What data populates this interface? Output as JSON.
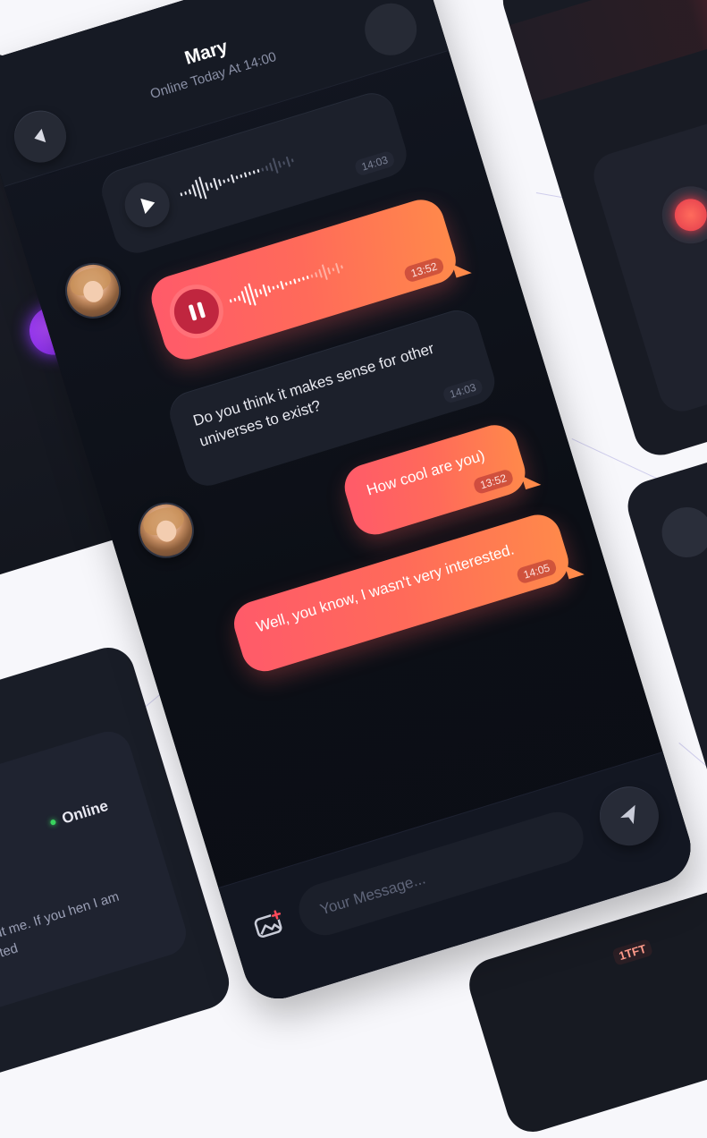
{
  "chat": {
    "contact_name": "Mary",
    "contact_status": "Online Today At 14:00",
    "messages": [
      {
        "type": "voice",
        "direction": "incoming",
        "time": "14:03"
      },
      {
        "type": "voice",
        "direction": "outgoing",
        "time": "13:52",
        "playing": true
      },
      {
        "type": "text",
        "direction": "incoming",
        "text": "Do you think it makes sense for other universes to exist?",
        "time": "14:03"
      },
      {
        "type": "text",
        "direction": "outgoing",
        "text": "How cool are you)",
        "time": "13:52"
      },
      {
        "type": "text",
        "direction": "outgoing",
        "text": "Well, you know, I wasn't very interested.",
        "time": "14:05"
      }
    ],
    "composer": {
      "placeholder": "Your Message..."
    }
  },
  "background_cards": {
    "profile": {
      "status": "Online",
      "bio": "ad about me. If you hen I am interested"
    },
    "tag": "1TFT"
  },
  "colors": {
    "accent_start": "#ff5a6a",
    "accent_end": "#ff8a4a",
    "background_dark": "#0d1018",
    "bubble_incoming": "#1c202b",
    "online_dot": "#39d45e"
  },
  "icons": [
    "back-arrow-icon",
    "play-icon",
    "pause-icon",
    "image-add-icon",
    "send-icon"
  ]
}
